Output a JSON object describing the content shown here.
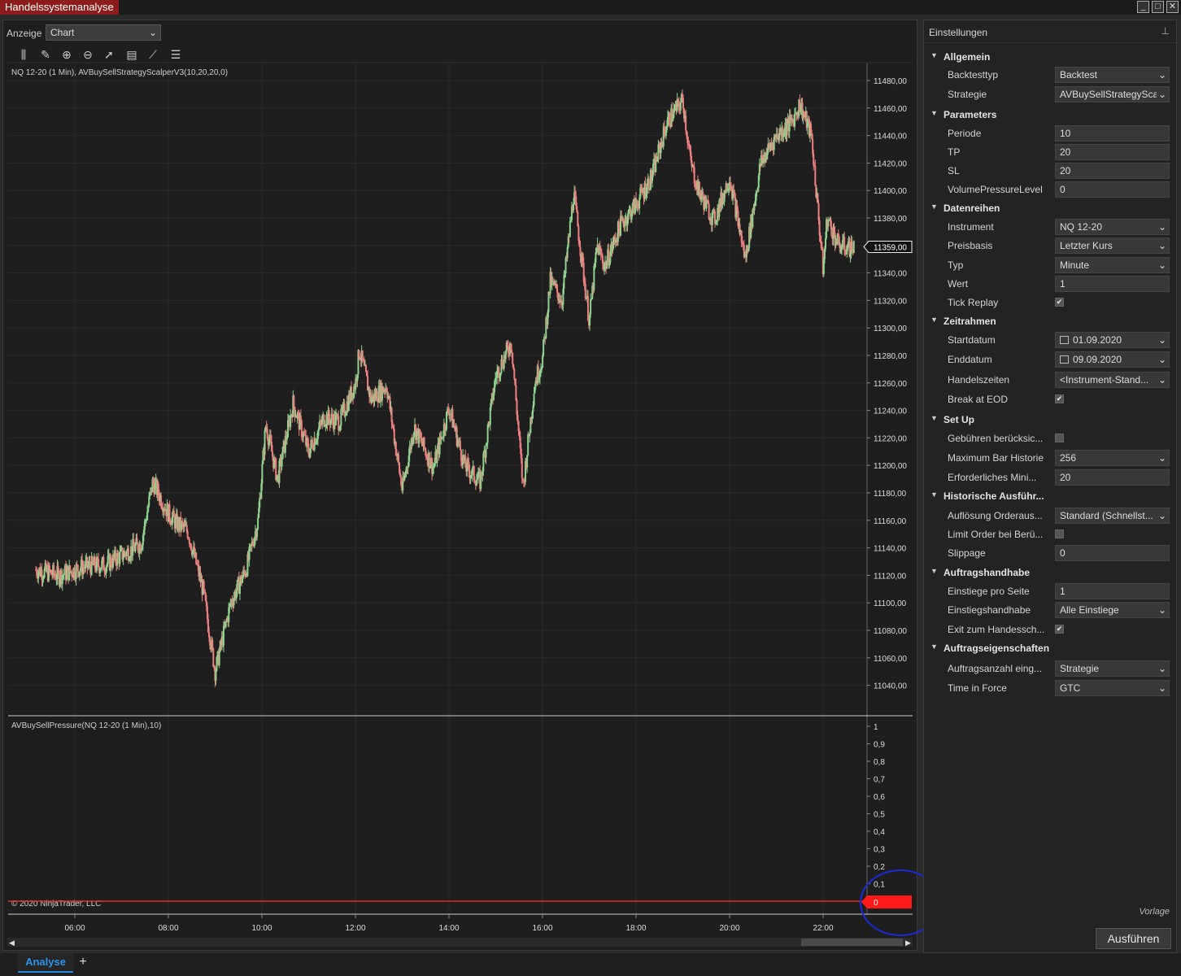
{
  "window": {
    "title": "Handelssystemanalyse",
    "min": "_",
    "max": "□",
    "close": "✕"
  },
  "toolbar": {
    "anzeige_label": "Anzeige",
    "anzeige_value": "Chart",
    "tools": [
      "bars-icon",
      "pencil-icon",
      "zoom-in-icon",
      "zoom-out-icon",
      "pointer-icon",
      "data-box-icon",
      "indicator-icon",
      "list-icon"
    ]
  },
  "chart": {
    "price_panel_label": "NQ 12-20 (1 Min), AVBuySellStrategyScalperV3(10,20,20,0)",
    "indicator_panel_label": "AVBuySellPressure(NQ 12-20 (1 Min),10)",
    "copyright": "© 2020 NinjaTrader, LLC",
    "price_axis": [
      "11480,00",
      "11460,00",
      "11440,00",
      "11420,00",
      "11400,00",
      "11380,00",
      "11360,00",
      "11340,00",
      "11320,00",
      "11300,00",
      "11280,00",
      "11260,00",
      "11240,00",
      "11220,00",
      "11200,00",
      "11180,00",
      "11160,00",
      "11140,00",
      "11120,00",
      "11100,00",
      "11080,00",
      "11060,00",
      "11040,00"
    ],
    "last_price": "11359,00",
    "indicator_axis": [
      "1",
      "0,9",
      "0,8",
      "0,7",
      "0,6",
      "0,5",
      "0,4",
      "0,3",
      "0,2",
      "0,1"
    ],
    "indicator_last": "0",
    "time_axis": [
      "06:00",
      "08:00",
      "10:00",
      "12:00",
      "14:00",
      "16:00",
      "18:00",
      "20:00",
      "22:00"
    ],
    "colors": {
      "up": "#8fd48f",
      "down": "#f08080",
      "indicator": "#e0301e",
      "annotation": "#1a2ad8"
    }
  },
  "chart_data": {
    "type": "line",
    "title": "NQ 12-20 (1 Min), AVBuySellStrategyScalperV3(10,20,20,0)",
    "xlabel": "",
    "ylabel": "",
    "x": [
      "05:10",
      "05:40",
      "06:10",
      "06:40",
      "07:10",
      "07:25",
      "07:40",
      "08:00",
      "08:10",
      "08:25",
      "08:45",
      "09:00",
      "09:20",
      "09:40",
      "09:55",
      "10:05",
      "10:20",
      "10:40",
      "11:00",
      "11:20",
      "11:40",
      "12:00",
      "12:05",
      "12:20",
      "12:40",
      "13:00",
      "13:15",
      "13:40",
      "14:00",
      "14:20",
      "14:40",
      "15:00",
      "15:20",
      "15:35",
      "15:50",
      "16:00",
      "16:10",
      "16:25",
      "16:40",
      "17:00",
      "17:10",
      "17:20",
      "17:40",
      "18:00",
      "18:20",
      "18:40",
      "19:00",
      "19:10",
      "19:20",
      "19:40",
      "20:00",
      "20:20",
      "20:40",
      "21:00",
      "21:20",
      "21:30",
      "21:45",
      "22:00",
      "22:05",
      "22:20",
      "22:40"
    ],
    "series": [
      {
        "values": [
          11124,
          11120,
          11126,
          11128,
          11138,
          11143,
          11188,
          11165,
          11158,
          11152,
          11108,
          11050,
          11100,
          11125,
          11160,
          11230,
          11190,
          11245,
          11210,
          11235,
          11232,
          11260,
          11284,
          11248,
          11258,
          11182,
          11228,
          11198,
          11242,
          11200,
          11188,
          11265,
          11290,
          11184,
          11260,
          11278,
          11334,
          11320,
          11398,
          11305,
          11360,
          11345,
          11375,
          11390,
          11410,
          11450,
          11466,
          11420,
          11400,
          11378,
          11410,
          11350,
          11420,
          11440,
          11450,
          11463,
          11440,
          11342,
          11380,
          11360,
          11358
        ]
      }
    ],
    "ylim": [
      11030,
      11490
    ],
    "indicator": {
      "name": "AVBuySellPressure",
      "values": [
        0,
        0
      ],
      "ylim": [
        0,
        1
      ]
    }
  },
  "settings": {
    "title": "Einstellungen",
    "vorlage": "Vorlage",
    "run_button": "Ausführen",
    "rows": [
      {
        "t": "cat",
        "label": "Allgemein"
      },
      {
        "t": "dd",
        "label": "Backtesttyp",
        "value": "Backtest"
      },
      {
        "t": "dd",
        "label": "Strategie",
        "value": "AVBuySellStrategySca"
      },
      {
        "t": "cat",
        "label": "Parameters"
      },
      {
        "t": "txt",
        "label": "Periode",
        "value": "10"
      },
      {
        "t": "txt",
        "label": "TP",
        "value": "20"
      },
      {
        "t": "txt",
        "label": "SL",
        "value": "20"
      },
      {
        "t": "txt",
        "label": "VolumePressureLevel",
        "value": "0"
      },
      {
        "t": "cat",
        "label": "Datenreihen"
      },
      {
        "t": "dd",
        "label": "Instrument",
        "value": "NQ 12-20"
      },
      {
        "t": "dd",
        "label": "Preisbasis",
        "value": "Letzter Kurs"
      },
      {
        "t": "dd",
        "label": "Typ",
        "value": "Minute"
      },
      {
        "t": "txt",
        "label": "Wert",
        "value": "1"
      },
      {
        "t": "cb",
        "label": "Tick Replay",
        "value": "✔"
      },
      {
        "t": "cat",
        "label": "Zeitrahmen"
      },
      {
        "t": "date",
        "label": "Startdatum",
        "value": "01.09.2020"
      },
      {
        "t": "date",
        "label": "Enddatum",
        "value": "09.09.2020"
      },
      {
        "t": "dd",
        "label": "Handelszeiten",
        "value": "<Instrument-Stand..."
      },
      {
        "t": "cb",
        "label": "Break at EOD",
        "value": "✔"
      },
      {
        "t": "cat",
        "label": "Set Up"
      },
      {
        "t": "cb",
        "label": "Gebühren berücksic...",
        "value": ""
      },
      {
        "t": "dd",
        "label": "Maximum Bar Historie",
        "value": "256"
      },
      {
        "t": "txt",
        "label": "Erforderliches Mini...",
        "value": "20"
      },
      {
        "t": "cat",
        "label": "Historische Ausführ..."
      },
      {
        "t": "dd",
        "label": "Auflösung Orderaus...",
        "value": "Standard (Schnellst..."
      },
      {
        "t": "cb",
        "label": "Limit Order bei Berü...",
        "value": ""
      },
      {
        "t": "txt",
        "label": "Slippage",
        "value": "0"
      },
      {
        "t": "cat",
        "label": "Auftragshandhabe"
      },
      {
        "t": "txt",
        "label": "Einstiege pro Seite",
        "value": "1"
      },
      {
        "t": "dd",
        "label": "Einstiegshandhabe",
        "value": "Alle Einstiege"
      },
      {
        "t": "cb",
        "label": "Exit zum Handessch...",
        "value": "✔"
      },
      {
        "t": "cat",
        "label": "Auftragseigenschaften"
      },
      {
        "t": "dd",
        "label": "Auftragsanzahl eing...",
        "value": "Strategie"
      },
      {
        "t": "dd",
        "label": "Time in Force",
        "value": "GTC"
      }
    ]
  },
  "tabs": {
    "active": "Analyse",
    "add": "+"
  }
}
